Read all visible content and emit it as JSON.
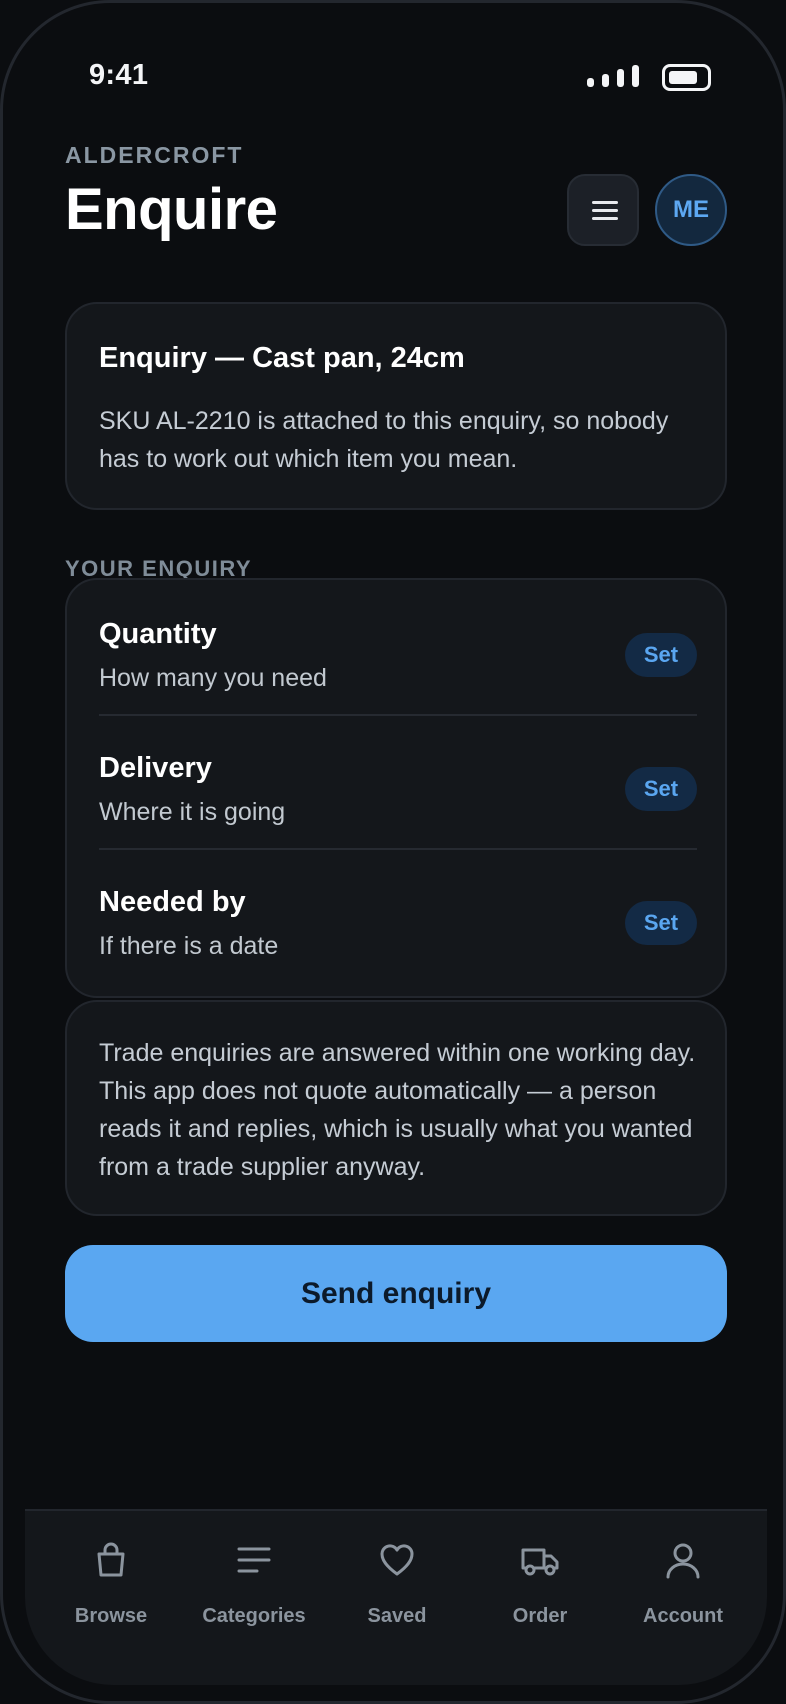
{
  "status_bar": {
    "time": "9:41"
  },
  "header": {
    "brand": "ALDERCROFT",
    "title": "Enquire",
    "avatar_initials": "ME"
  },
  "context_card": {
    "title": "Enquiry — Cast pan, 24cm",
    "body": "SKU AL-2210 is attached to this enquiry, so nobody has to work out which item you mean."
  },
  "enquiry": {
    "section_label": "YOUR ENQUIRY",
    "fields": [
      {
        "label": "Quantity",
        "hint": "How many you need",
        "action": "Set"
      },
      {
        "label": "Delivery",
        "hint": "Where it is going",
        "action": "Set"
      },
      {
        "label": "Needed by",
        "hint": "If there is a date",
        "action": "Set"
      }
    ]
  },
  "note": {
    "text": "Trade enquiries are answered within one working day. This app does not quote automatically — a person reads it and replies, which is usually what you wanted from a trade supplier anyway."
  },
  "send_button": {
    "label": "Send enquiry"
  },
  "tab_bar": {
    "tabs": [
      {
        "label": "Browse",
        "icon": "shopping-bag-icon"
      },
      {
        "label": "Categories",
        "icon": "list-lines-icon"
      },
      {
        "label": "Saved",
        "icon": "heart-icon"
      },
      {
        "label": "Order",
        "icon": "truck-icon"
      },
      {
        "label": "Account",
        "icon": "user-icon"
      }
    ]
  },
  "colors": {
    "background": "#0b0d10",
    "card": "#14171b",
    "accent": "#5aa7f1",
    "muted_text": "#8b949e"
  }
}
